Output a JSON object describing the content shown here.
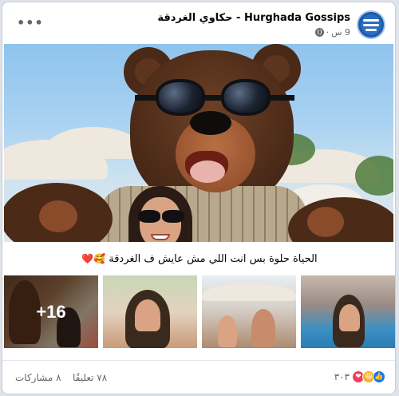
{
  "post": {
    "page_name": "Hurghada Gossips - حكاوي الغردقة",
    "time": "9 س",
    "separator": "·",
    "caption": "الحياة حلوة بس انت اللي مش عايش ف الغردقة",
    "caption_emoji": "🥰❤️",
    "extra_photos": "+16"
  },
  "icons": {
    "more": "more-options-icon",
    "privacy": "globe-icon",
    "reactions": [
      "like-icon",
      "haha-icon",
      "love-icon"
    ]
  },
  "footer": {
    "reaction_count": "٣٠٣",
    "comments": "٧٨ تعليقًا",
    "shares": "٨ مشاركات"
  },
  "colors": {
    "like": "#1877f2",
    "love": "#f33e58",
    "haha": "#f7b125",
    "secondary_text": "#65676b"
  }
}
